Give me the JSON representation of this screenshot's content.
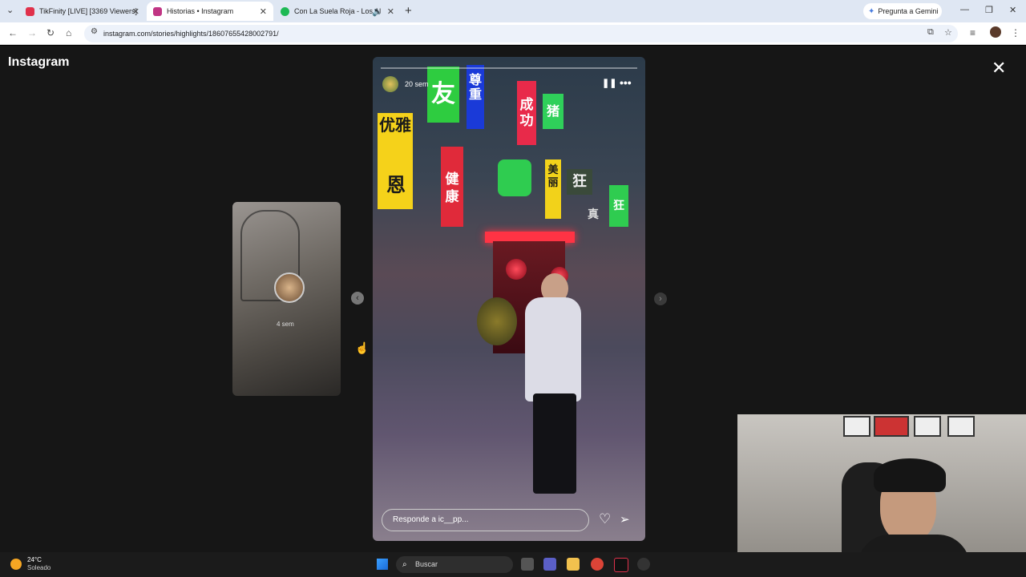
{
  "browser": {
    "tabs": [
      {
        "label": "TikFinity [LIVE] [3369 Viewers]",
        "active": false,
        "color": "#e0314b"
      },
      {
        "label": "Historias • Instagram",
        "active": true,
        "color": "#c13584"
      },
      {
        "label": "Con La Suela Roja - Los Ale...",
        "active": false,
        "color": "#1db954"
      }
    ],
    "new_tab": "+",
    "gemini_label": "Pregunta a Gemini",
    "url": "instagram.com/stories/highlights/18607655428002791/"
  },
  "instagram": {
    "logo": "Instagram",
    "story_time": "20 sem",
    "prev_time": "4 sem",
    "reply_placeholder": "Responde a ic__pp..."
  },
  "taskbar": {
    "temperature": "24°C",
    "condition": "Soleado",
    "search_label": "Buscar"
  },
  "signs": [
    "友",
    "尊重",
    "成功",
    "猪",
    "优雅",
    "恩",
    "健康",
    "美丽",
    "狂",
    "真",
    "狂"
  ]
}
